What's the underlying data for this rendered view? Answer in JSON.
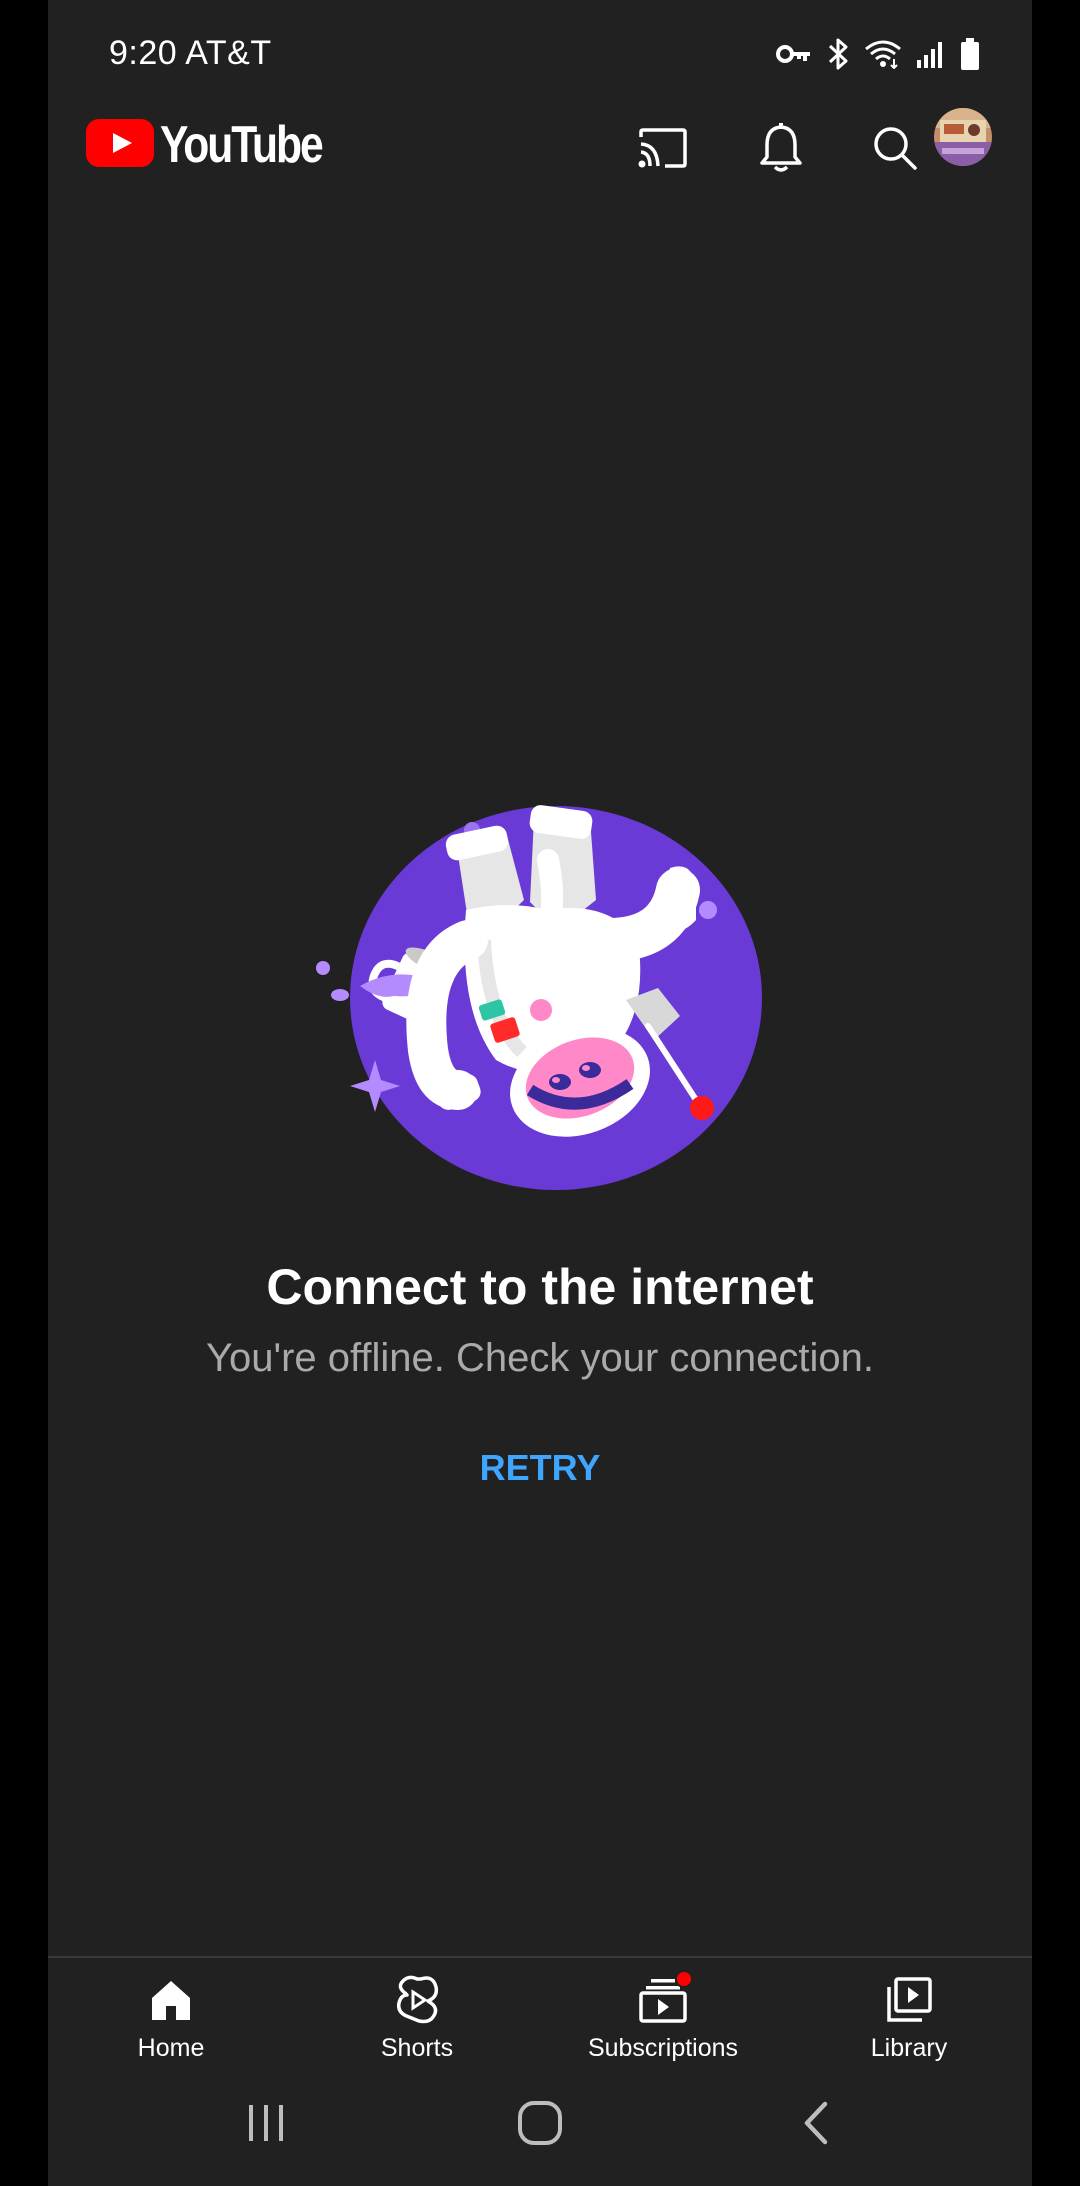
{
  "status_bar": {
    "time_carrier": "9:20 AT&T",
    "icons": [
      "vpn-key-icon",
      "bluetooth-icon",
      "wifi-icon",
      "signal-icon",
      "battery-icon"
    ]
  },
  "app_bar": {
    "logo_text": "YouTube",
    "brand_color": "#ff0000",
    "actions": [
      "cast-icon",
      "notifications-icon",
      "search-icon",
      "account-avatar"
    ]
  },
  "offline": {
    "title": "Connect to the internet",
    "subtitle": "You're offline. Check your connection.",
    "retry_label": "RETRY",
    "accent_color": "#3ea6ff"
  },
  "bottom_nav": {
    "items": [
      {
        "label": "Home",
        "icon": "home-icon",
        "selected": true
      },
      {
        "label": "Shorts",
        "icon": "shorts-icon"
      },
      {
        "label": "Subscriptions",
        "icon": "subscriptions-icon",
        "badge": true
      },
      {
        "label": "Library",
        "icon": "library-icon"
      }
    ]
  },
  "system_nav": [
    "recents-icon",
    "home-circle-icon",
    "back-icon"
  ]
}
